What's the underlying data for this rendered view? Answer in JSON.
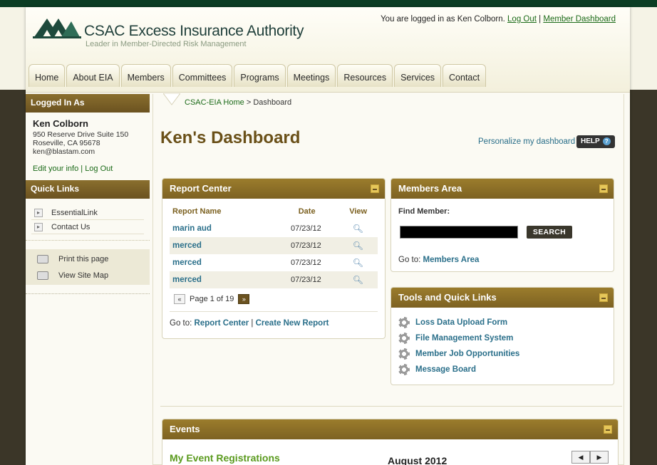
{
  "header": {
    "org_name": "CSAC Excess Insurance Authority",
    "tagline": "Leader  in Member-Directed Risk Management",
    "login_status": "You are logged in as Ken Colborn.",
    "logout_link": "Log Out",
    "separator": "|",
    "member_dashboard_link": "Member Dashboard"
  },
  "nav": [
    "Home",
    "About  EIA",
    "Members",
    "Committees",
    "Programs",
    "Meetings",
    "Resources",
    "Services",
    "Contact"
  ],
  "sidebar": {
    "logged_in_heading": "Logged In As",
    "user_name": "Ken Colborn",
    "address1": "950 Reserve Drive Suite 150",
    "address2": "Roseville, CA 95678",
    "email": "ken@blastam.com",
    "edit_info": "Edit your info",
    "sep": "|",
    "logout": "Log Out",
    "quick_links_heading": "Quick Links",
    "quick_links": [
      "EssentialLink",
      "Contact Us"
    ],
    "print_label": "Print this page",
    "sitemap_label": "View Site Map"
  },
  "breadcrumb": {
    "home": "CSAC-EIA Home",
    "sep": ">",
    "current": "Dashboard"
  },
  "main": {
    "title": "Ken's Dashboard",
    "personalize": "Personalize my dashboard",
    "help": "HELP",
    "help_glyph": "?"
  },
  "report_center": {
    "heading": "Report Center",
    "col_name": "Report Name",
    "col_date": "Date",
    "col_view": "View",
    "rows": [
      {
        "name": "marin aud",
        "date": "07/23/12"
      },
      {
        "name": "merced",
        "date": "07/23/12"
      },
      {
        "name": "merced",
        "date": "07/23/12"
      },
      {
        "name": "merced",
        "date": "07/23/12"
      }
    ],
    "view_icon": "magnifier-icon",
    "prev": "«",
    "page_text": "Page 1 of 19",
    "next": "»",
    "goto_label": "Go to:",
    "goto_link": "Report Center",
    "goto_sep": "|",
    "create_link": "Create New Report"
  },
  "members_area": {
    "heading": "Members Area",
    "find_label": "Find Member:",
    "search_value": "",
    "search_button": "SEARCH",
    "goto_label": "Go to:",
    "goto_link": "Members Area"
  },
  "tools": {
    "heading": "Tools and Quick Links",
    "items": [
      "Loss Data Upload Form",
      "File Management System",
      "Member Job Opportunities",
      "Message Board"
    ]
  },
  "events": {
    "heading": "Events",
    "subheading": "My Event Registrations",
    "month": "August 2012",
    "prev": "◀",
    "next": "▶"
  },
  "colors": {
    "panel_header": "#8a6f2e",
    "link": "#2a6f8a",
    "green_link": "#1b6a18",
    "title_brown": "#6a5018"
  }
}
